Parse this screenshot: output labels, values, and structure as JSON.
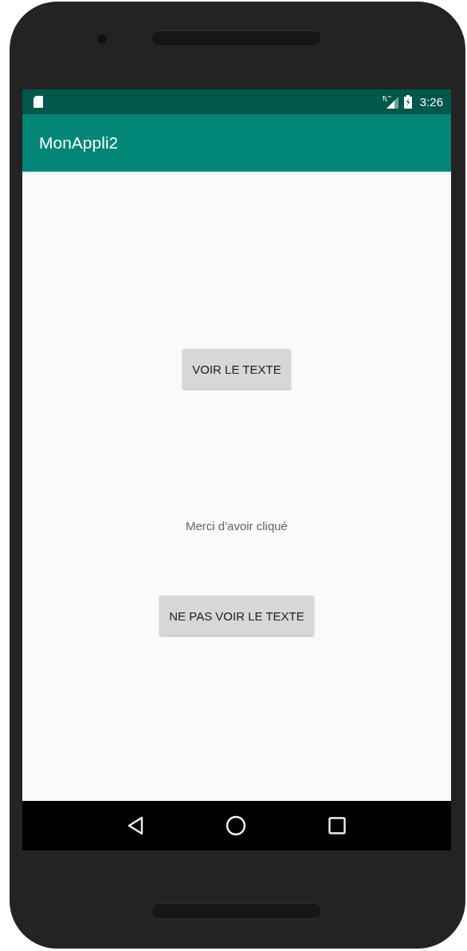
{
  "status_bar": {
    "time": "3:26"
  },
  "app_bar": {
    "title": "MonAppli2"
  },
  "content": [
    {
      "kind": "button",
      "label": "VOIR LE TEXTE"
    },
    {
      "kind": "text",
      "label": "Merci d'avoir cliqué"
    },
    {
      "kind": "button",
      "label": "NE PAS VOIR LE TEXTE"
    }
  ]
}
